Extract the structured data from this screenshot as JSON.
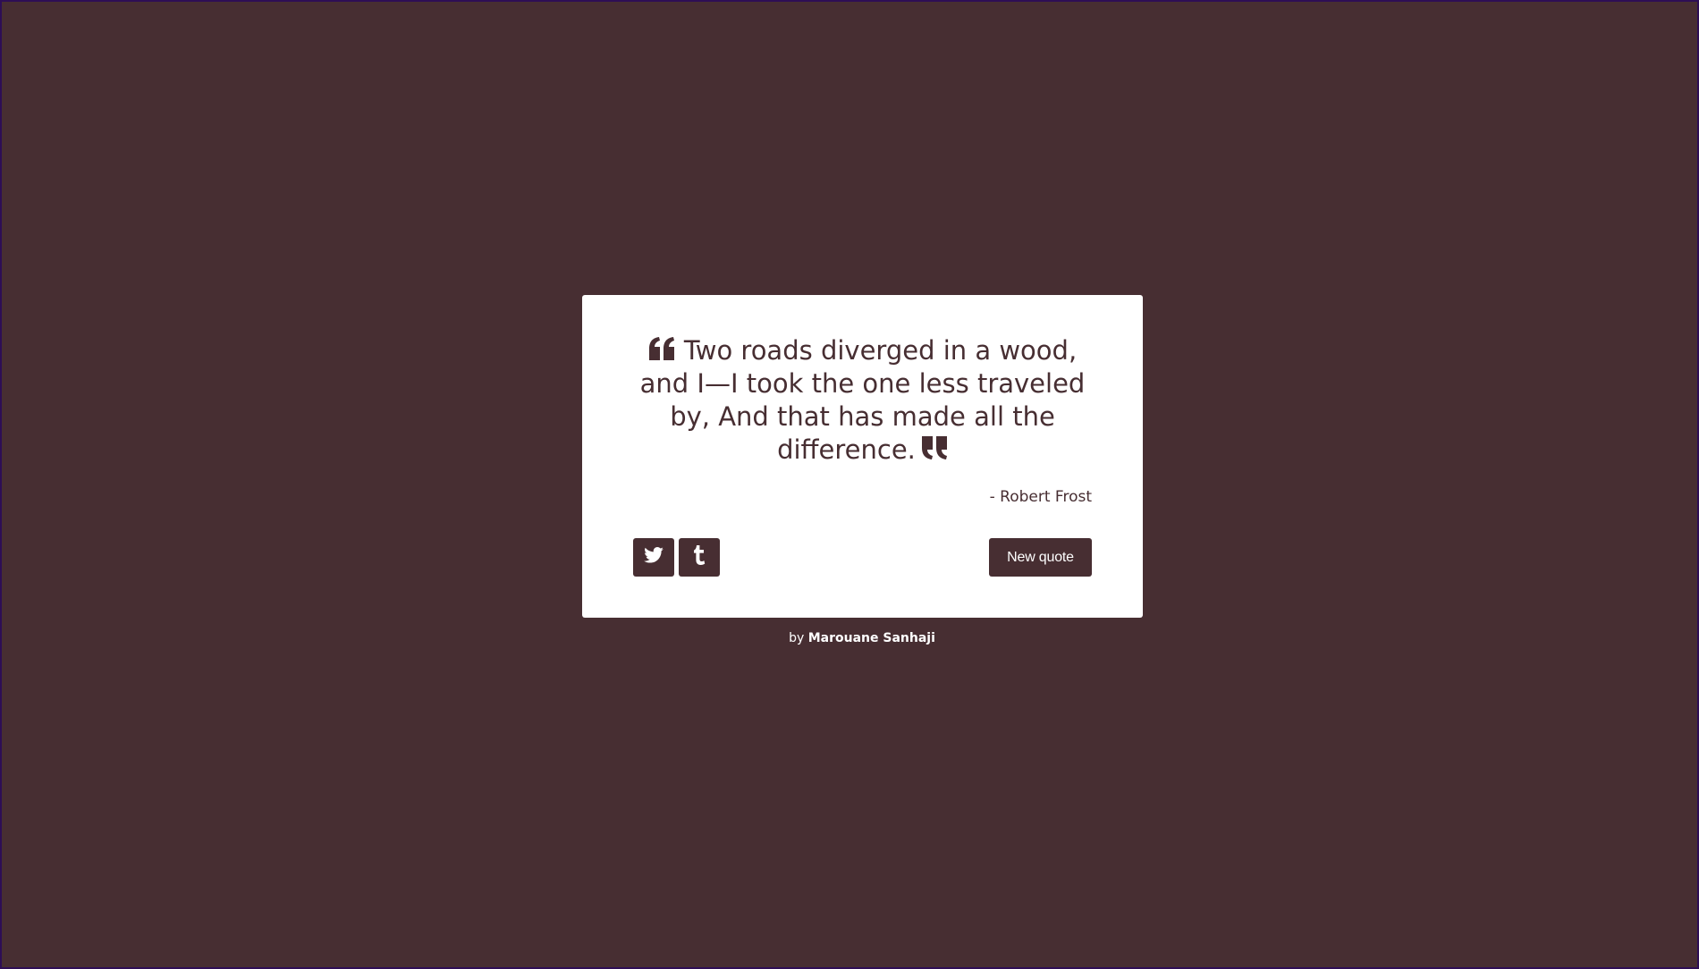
{
  "quote": {
    "text": "Two roads diverged in a wood, and I—I took the one less traveled by, And that has made all the difference.",
    "author": "- Robert Frost",
    "open_icon": "quote-left-icon",
    "close_icon": "quote-right-icon"
  },
  "actions": {
    "tweet_icon": "twitter-icon",
    "tumblr_icon": "tumblr-icon",
    "new_quote_label": "New quote"
  },
  "footer": {
    "prefix": "by",
    "name": "Marouane Sanhaji"
  },
  "colors": {
    "background": "#472e32",
    "card": "#ffffff",
    "accent": "#472e32"
  }
}
